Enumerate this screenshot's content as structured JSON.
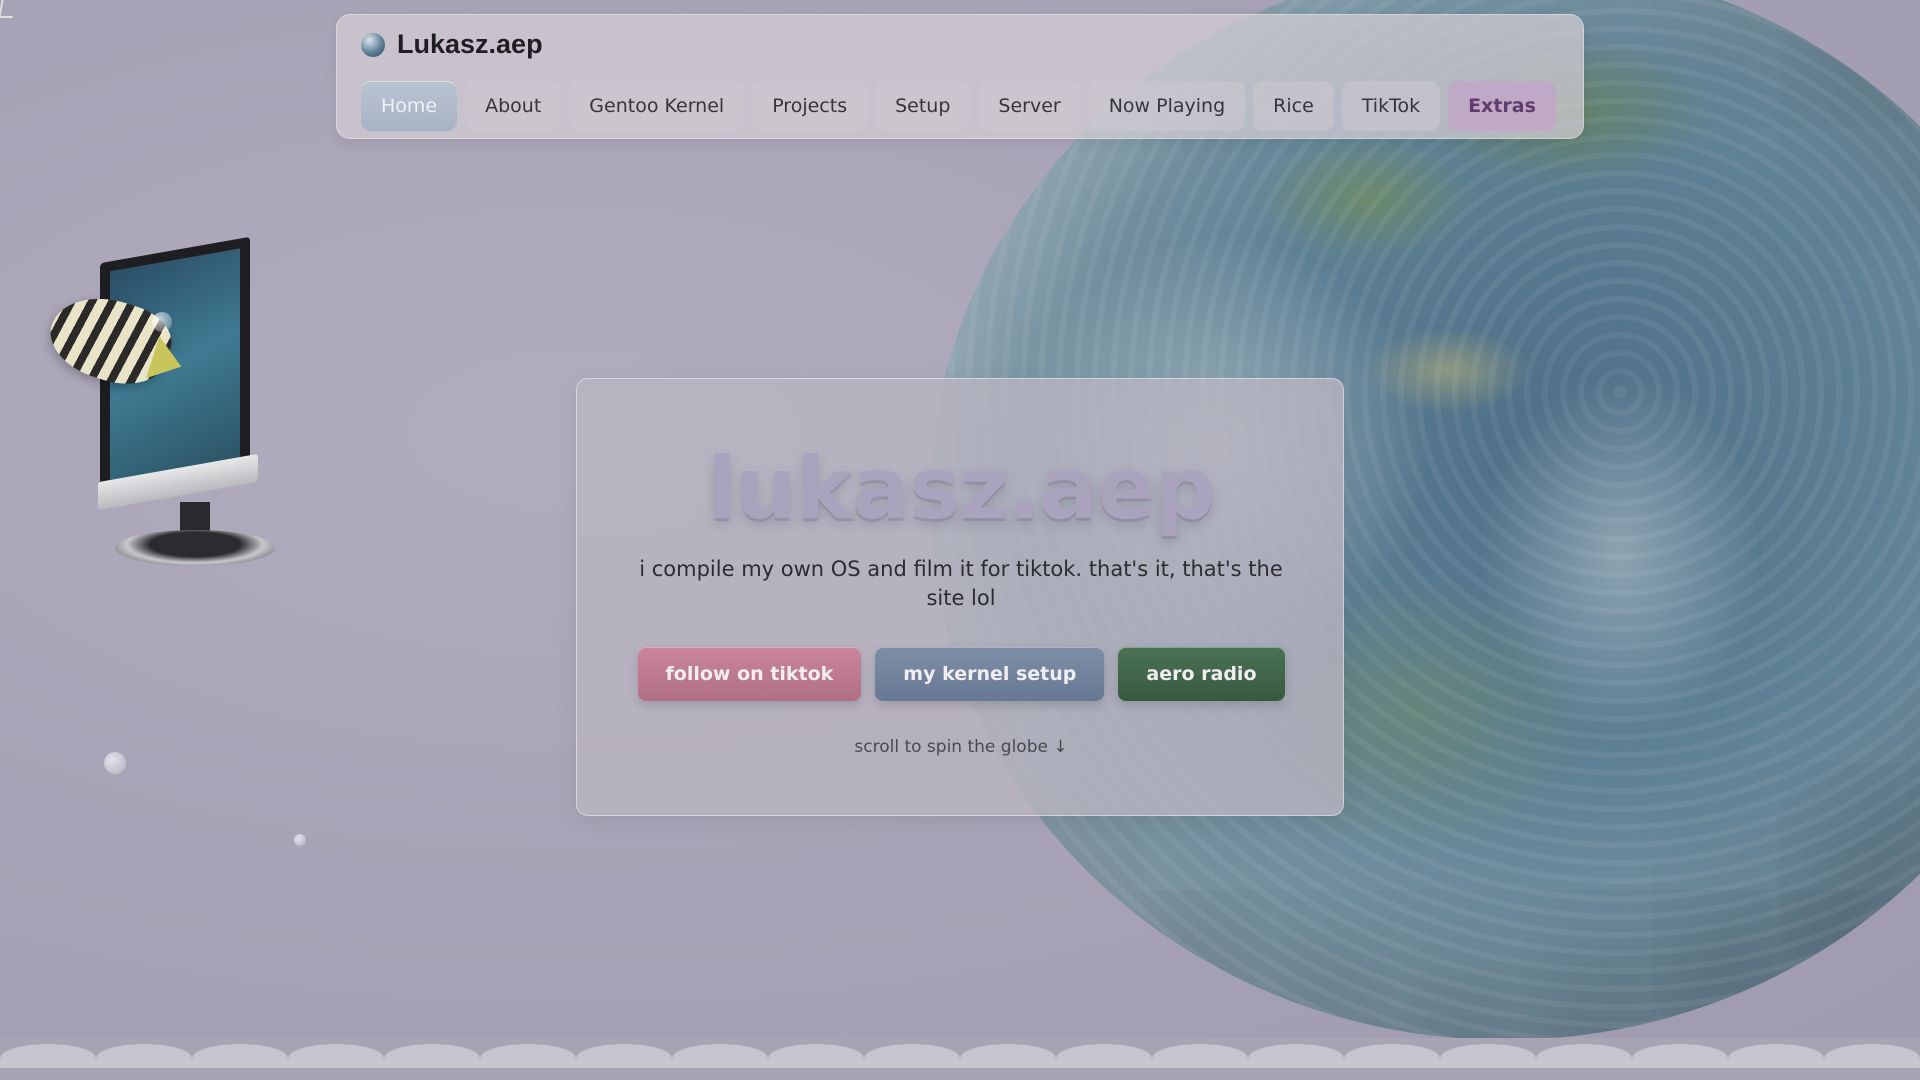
{
  "site": {
    "brand": "Lukasz.aep",
    "icons": {
      "brand": "globe-orb-icon",
      "cursor": "cursor-icon"
    }
  },
  "nav": {
    "items": [
      {
        "label": "Home",
        "active": true
      },
      {
        "label": "About"
      },
      {
        "label": "Gentoo Kernel"
      },
      {
        "label": "Projects"
      },
      {
        "label": "Setup"
      },
      {
        "label": "Server"
      },
      {
        "label": "Now Playing"
      },
      {
        "label": "Rice"
      },
      {
        "label": "TikTok"
      },
      {
        "label": "Extras",
        "highlight": true
      }
    ]
  },
  "hero": {
    "title": "lukasz.aep",
    "subtitle": "i compile my own OS and film it for tiktok. that's it, that's the site lol",
    "buttons": [
      {
        "label": "follow on tiktok",
        "color": "#b97890"
      },
      {
        "label": "my kernel setup",
        "color": "#7182a0"
      },
      {
        "label": "aero radio",
        "color": "#3f6648"
      }
    ],
    "hint": "scroll to spin the globe ↓"
  },
  "colors": {
    "background": "#a8a4b6",
    "accent_active_tab": "#b0bccd",
    "extras_tab": "#c0a9c6"
  }
}
